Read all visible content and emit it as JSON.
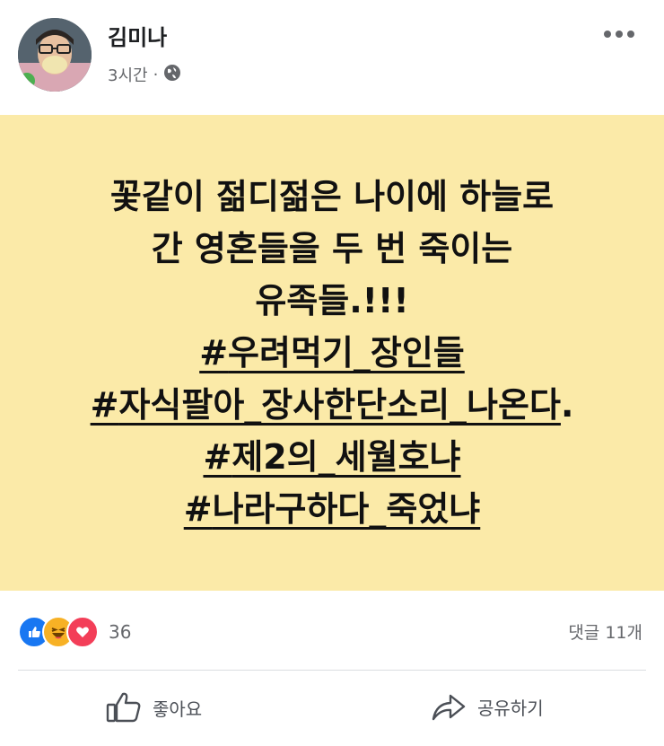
{
  "post": {
    "author": "김미나",
    "time": "3시간",
    "separator": "·",
    "privacy_icon": "globe-icon",
    "more_icon": "more-options-icon",
    "background_color": "#fbeaa8",
    "text_lines": [
      "꽃같이 젊디젊은 나이에 하늘로",
      "간 영혼들을 두 번 죽이는",
      "유족들.!!!"
    ],
    "hashtags": [
      {
        "symbol": "#",
        "tag": "우려먹기_장인들",
        "suffix": ""
      },
      {
        "symbol": "#",
        "tag": "자식팔아_장사한단소리_나온다",
        "suffix": "."
      },
      {
        "symbol": "#",
        "tag": "제2의_세월호냐",
        "suffix": ""
      },
      {
        "symbol": "#",
        "tag": "나라구하다_죽었냐",
        "suffix": ""
      }
    ]
  },
  "reactions": {
    "icons": [
      "like-reaction-icon",
      "haha-reaction-icon",
      "love-reaction-icon"
    ],
    "count": "36"
  },
  "comments": {
    "label": "댓글 11개"
  },
  "actions": {
    "like_label": "좋아요",
    "like_icon": "thumbs-up-icon",
    "share_label": "공유하기",
    "share_icon": "share-arrow-icon"
  },
  "colors": {
    "reaction_like": "#1877f2",
    "reaction_haha": "#f7b125",
    "reaction_love": "#f33e58",
    "muted_text": "#65676b"
  }
}
